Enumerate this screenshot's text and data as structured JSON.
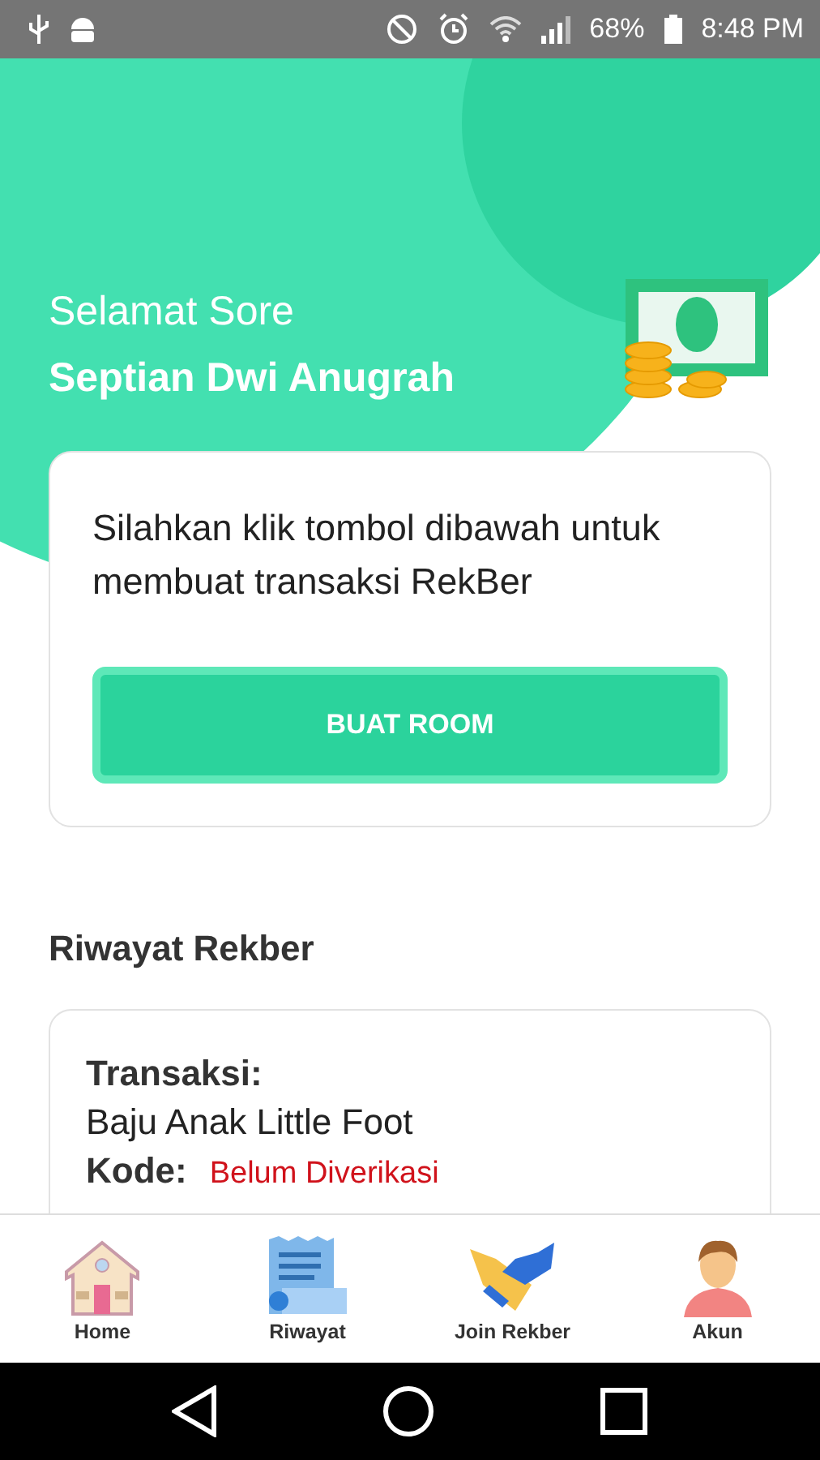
{
  "status_bar": {
    "battery": "68%",
    "time": "8:48 PM"
  },
  "header": {
    "greeting": "Selamat Sore",
    "name": "Septian Dwi Anugrah"
  },
  "create_card": {
    "message": "Silahkan klik tombol dibawah untuk membuat transaksi RekBer",
    "button": "BUAT ROOM"
  },
  "history": {
    "title": "Riwayat Rekber",
    "items": [
      {
        "transaction_label": "Transaksi:",
        "transaction": "Baju Anak Little Foot",
        "code_label": "Kode:",
        "code_status": "Belum Diverikasi"
      }
    ]
  },
  "bottom_nav": [
    {
      "kind": "home",
      "label": "Home"
    },
    {
      "kind": "receipt",
      "label": "Riwayat"
    },
    {
      "kind": "handshake",
      "label": "Join Rekber"
    },
    {
      "kind": "account",
      "label": "Akun"
    }
  ]
}
